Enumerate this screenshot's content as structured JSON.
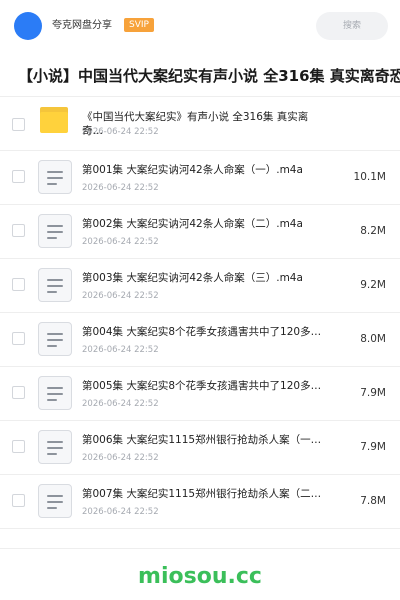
{
  "header": {
    "username": "夸克网盘分享",
    "badge": "SVIP",
    "search_placeholder": "搜索"
  },
  "page_title": "【小说】中国当代大案纪实有声小说 全316集 真实离奇恐怖",
  "folder": {
    "name": "《中国当代大案纪实》有声小说 全316集 真实离奇…",
    "date": "2026-06-24 22:52"
  },
  "files": [
    {
      "name": "第001集 大案纪实讷河42条人命案（一）.m4a",
      "date": "2026-06-24 22:52",
      "size": "10.1M"
    },
    {
      "name": "第002集 大案纪实讷河42条人命案（二）.m4a",
      "date": "2026-06-24 22:52",
      "size": "8.2M"
    },
    {
      "name": "第003集 大案纪实讷河42条人命案（三）.m4a",
      "date": "2026-06-24 22:52",
      "size": "9.2M"
    },
    {
      "name": "第004集 大案纪实8个花季女孩遇害共中了120多…",
      "date": "2026-06-24 22:52",
      "size": "8.0M"
    },
    {
      "name": "第005集 大案纪实8个花季女孩遇害共中了120多…",
      "date": "2026-06-24 22:52",
      "size": "7.9M"
    },
    {
      "name": "第006集 大案纪实1115郑州银行抢劫杀人案（一…",
      "date": "2026-06-24 22:52",
      "size": "7.9M"
    },
    {
      "name": "第007集 大案纪实1115郑州银行抢劫杀人案（二…",
      "date": "2026-06-24 22:52",
      "size": "7.8M"
    }
  ],
  "watermark": "miosou.cc"
}
